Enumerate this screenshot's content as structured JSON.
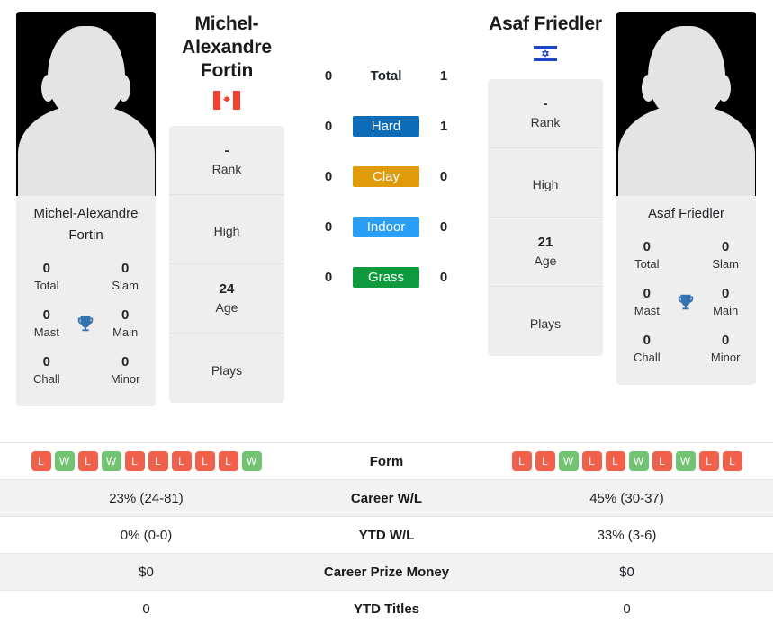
{
  "players": {
    "left": {
      "name": "Michel-Alexandre Fortin",
      "photo_caption": "Michel-Alexandre Fortin",
      "country_icon": "canada-flag-icon",
      "titles": [
        {
          "value": "0",
          "label": "Total"
        },
        {
          "value": "0",
          "label": "Slam"
        },
        {
          "value": "0",
          "label": "Mast"
        },
        {
          "value": "0",
          "label": "Main"
        },
        {
          "value": "0",
          "label": "Chall"
        },
        {
          "value": "0",
          "label": "Minor"
        }
      ],
      "info": [
        {
          "value": "-",
          "label": "Rank"
        },
        {
          "value": "",
          "label": "High"
        },
        {
          "value": "24",
          "label": "Age"
        },
        {
          "value": "",
          "label": "Plays"
        }
      ],
      "form": [
        "L",
        "W",
        "L",
        "W",
        "L",
        "L",
        "L",
        "L",
        "L",
        "W"
      ],
      "career_wl": "23% (24-81)",
      "ytd_wl": "0% (0-0)",
      "career_prize_money": "$0",
      "ytd_titles": "0",
      "surface_wins": {
        "total": "0",
        "hard": "0",
        "clay": "0",
        "indoor": "0",
        "grass": "0"
      }
    },
    "right": {
      "name": "Asaf Friedler",
      "photo_caption": "Asaf Friedler",
      "country_icon": "israel-flag-icon",
      "titles": [
        {
          "value": "0",
          "label": "Total"
        },
        {
          "value": "0",
          "label": "Slam"
        },
        {
          "value": "0",
          "label": "Mast"
        },
        {
          "value": "0",
          "label": "Main"
        },
        {
          "value": "0",
          "label": "Chall"
        },
        {
          "value": "0",
          "label": "Minor"
        }
      ],
      "info": [
        {
          "value": "-",
          "label": "Rank"
        },
        {
          "value": "",
          "label": "High"
        },
        {
          "value": "21",
          "label": "Age"
        },
        {
          "value": "",
          "label": "Plays"
        }
      ],
      "form": [
        "L",
        "L",
        "W",
        "L",
        "L",
        "W",
        "L",
        "W",
        "L",
        "L"
      ],
      "career_wl": "45% (30-37)",
      "ytd_wl": "33% (3-6)",
      "career_prize_money": "$0",
      "ytd_titles": "0",
      "surface_wins": {
        "total": "1",
        "hard": "1",
        "clay": "0",
        "indoor": "0",
        "grass": "0"
      }
    }
  },
  "surfaces": [
    {
      "key": "total",
      "label": "Total",
      "color": "transparent"
    },
    {
      "key": "hard",
      "label": "Hard",
      "color": "#0d6cb8"
    },
    {
      "key": "clay",
      "label": "Clay",
      "color": "#e09b0a"
    },
    {
      "key": "indoor",
      "label": "Indoor",
      "color": "#2a9df4"
    },
    {
      "key": "grass",
      "label": "Grass",
      "color": "#0f9b3d"
    }
  ],
  "table": {
    "rows": [
      {
        "label": "Form"
      },
      {
        "label": "Career W/L"
      },
      {
        "label": "YTD W/L"
      },
      {
        "label": "Career Prize Money"
      },
      {
        "label": "YTD Titles"
      }
    ]
  },
  "colors": {
    "win_badge": "#72c472",
    "loss_badge": "#f1604a",
    "trophy": "#3572b0",
    "panel_bg": "#eeeeee"
  },
  "icons": {
    "trophy": "trophy-icon"
  }
}
